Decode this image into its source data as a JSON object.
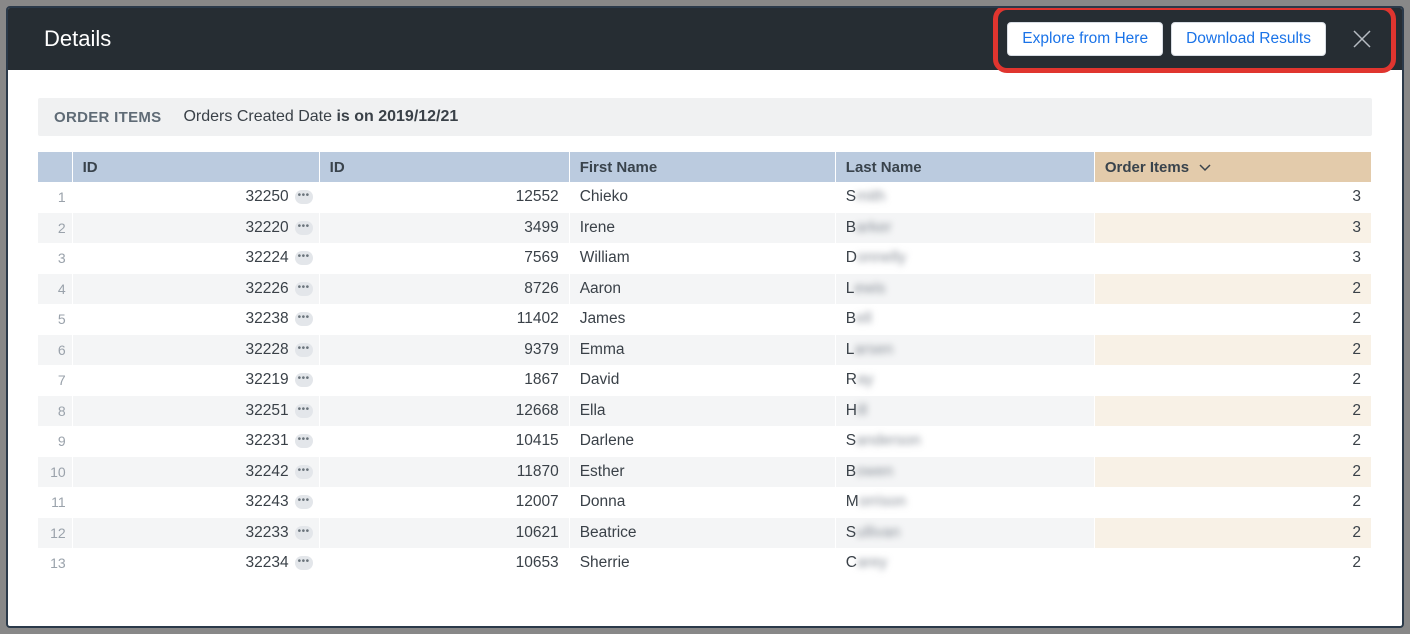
{
  "modal": {
    "title": "Details",
    "buttons": {
      "explore": "Explore from Here",
      "download": "Download Results"
    }
  },
  "filter": {
    "label": "ORDER ITEMS",
    "prefix": "Orders Created Date ",
    "bold": "is on 2019/12/21"
  },
  "columns": {
    "id1": "ID",
    "id2": "ID",
    "first_name": "First Name",
    "last_name": "Last Name",
    "order_items": "Order Items"
  },
  "rows": [
    {
      "n": "1",
      "id1": "32250",
      "id2": "12552",
      "fname": "Chieko",
      "ln_first": "S",
      "ln_rest": "mith",
      "items": "3"
    },
    {
      "n": "2",
      "id1": "32220",
      "id2": "3499",
      "fname": "Irene",
      "ln_first": "B",
      "ln_rest": "arker",
      "items": "3"
    },
    {
      "n": "3",
      "id1": "32224",
      "id2": "7569",
      "fname": "William",
      "ln_first": "D",
      "ln_rest": "onnelly",
      "items": "3"
    },
    {
      "n": "4",
      "id1": "32226",
      "id2": "8726",
      "fname": "Aaron",
      "ln_first": "L",
      "ln_rest": "ewis",
      "items": "2"
    },
    {
      "n": "5",
      "id1": "32238",
      "id2": "11402",
      "fname": "James",
      "ln_first": "B",
      "ln_rest": "ell",
      "items": "2"
    },
    {
      "n": "6",
      "id1": "32228",
      "id2": "9379",
      "fname": "Emma",
      "ln_first": "L",
      "ln_rest": "arsen",
      "items": "2"
    },
    {
      "n": "7",
      "id1": "32219",
      "id2": "1867",
      "fname": "David",
      "ln_first": "R",
      "ln_rest": "ay",
      "items": "2"
    },
    {
      "n": "8",
      "id1": "32251",
      "id2": "12668",
      "fname": "Ella",
      "ln_first": "H",
      "ln_rest": "ill",
      "items": "2"
    },
    {
      "n": "9",
      "id1": "32231",
      "id2": "10415",
      "fname": "Darlene",
      "ln_first": "S",
      "ln_rest": "anderson",
      "items": "2"
    },
    {
      "n": "10",
      "id1": "32242",
      "id2": "11870",
      "fname": "Esther",
      "ln_first": "B",
      "ln_rest": "owen",
      "items": "2"
    },
    {
      "n": "11",
      "id1": "32243",
      "id2": "12007",
      "fname": "Donna",
      "ln_first": "M",
      "ln_rest": "orrison",
      "items": "2"
    },
    {
      "n": "12",
      "id1": "32233",
      "id2": "10621",
      "fname": "Beatrice",
      "ln_first": "S",
      "ln_rest": "ullivan",
      "items": "2"
    },
    {
      "n": "13",
      "id1": "32234",
      "id2": "10653",
      "fname": "Sherrie",
      "ln_first": "C",
      "ln_rest": "arey",
      "items": "2"
    }
  ],
  "glyphs": {
    "more": "•••"
  }
}
